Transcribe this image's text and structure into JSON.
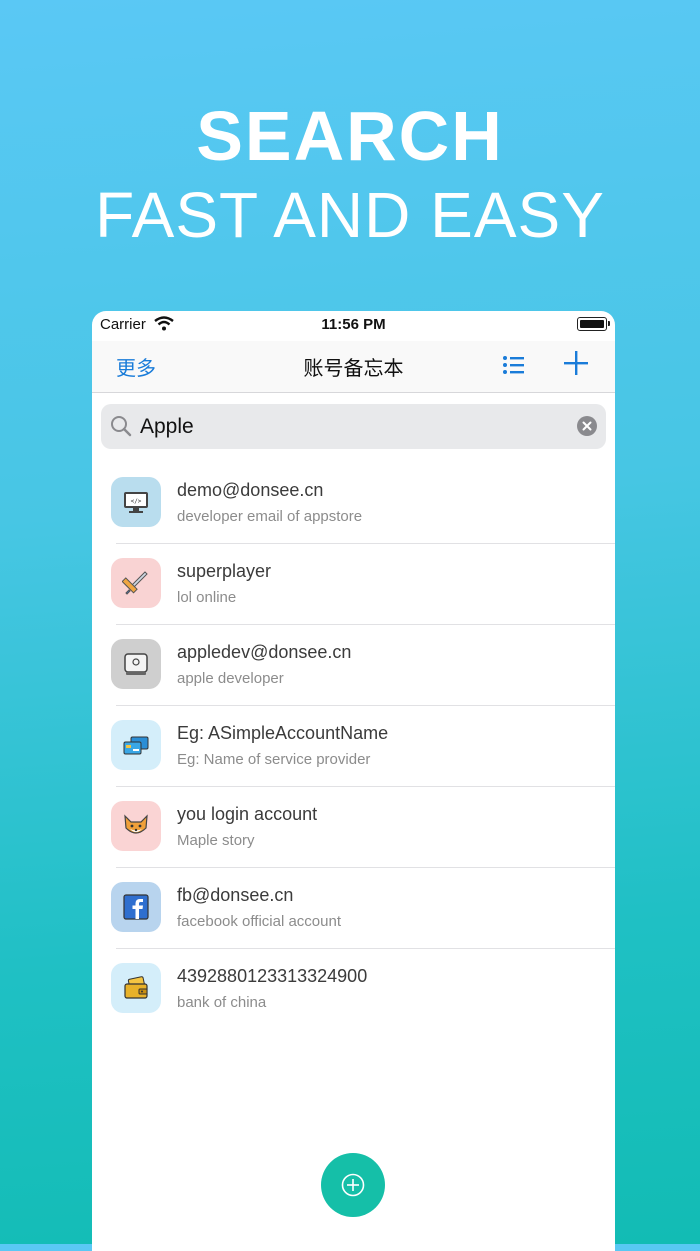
{
  "promo": {
    "headline": "SEARCH",
    "subheadline": "FAST AND EASY"
  },
  "status_bar": {
    "carrier": "Carrier",
    "time": "11:56 PM"
  },
  "nav": {
    "more_label": "更多",
    "title": "账号备忘本",
    "list_icon": "list-icon",
    "add_icon": "plus-icon",
    "accent": "#1a7cd9"
  },
  "search": {
    "value": "Apple",
    "icon": "search-icon",
    "clear_icon": "clear-icon"
  },
  "accounts": [
    {
      "title": "demo@donsee.cn",
      "subtitle": "developer email of appstore",
      "icon": "monitor-code-icon",
      "color": "#b9ddee"
    },
    {
      "title": "superplayer",
      "subtitle": "lol online",
      "icon": "sword-icon",
      "color": "#f9d3d3"
    },
    {
      "title": "appledev@donsee.cn",
      "subtitle": "apple developer",
      "icon": "mac-mini-icon",
      "color": "#cfcfcf"
    },
    {
      "title": "Eg: ASimpleAccountName",
      "subtitle": "Eg: Name of service provider",
      "icon": "cards-icon",
      "color": "#d4eefa"
    },
    {
      "title": "you login account",
      "subtitle": "Maple story",
      "icon": "fox-icon",
      "color": "#fad4d4"
    },
    {
      "title": "fb@donsee.cn",
      "subtitle": "facebook official account",
      "icon": "facebook-icon",
      "color": "#b8d4ee"
    },
    {
      "title": "4392880123313324900",
      "subtitle": "bank of china",
      "icon": "wallet-icon",
      "color": "#d4eefa"
    }
  ],
  "fab": {
    "icon": "add-circle-icon",
    "color": "#15bfa8"
  }
}
